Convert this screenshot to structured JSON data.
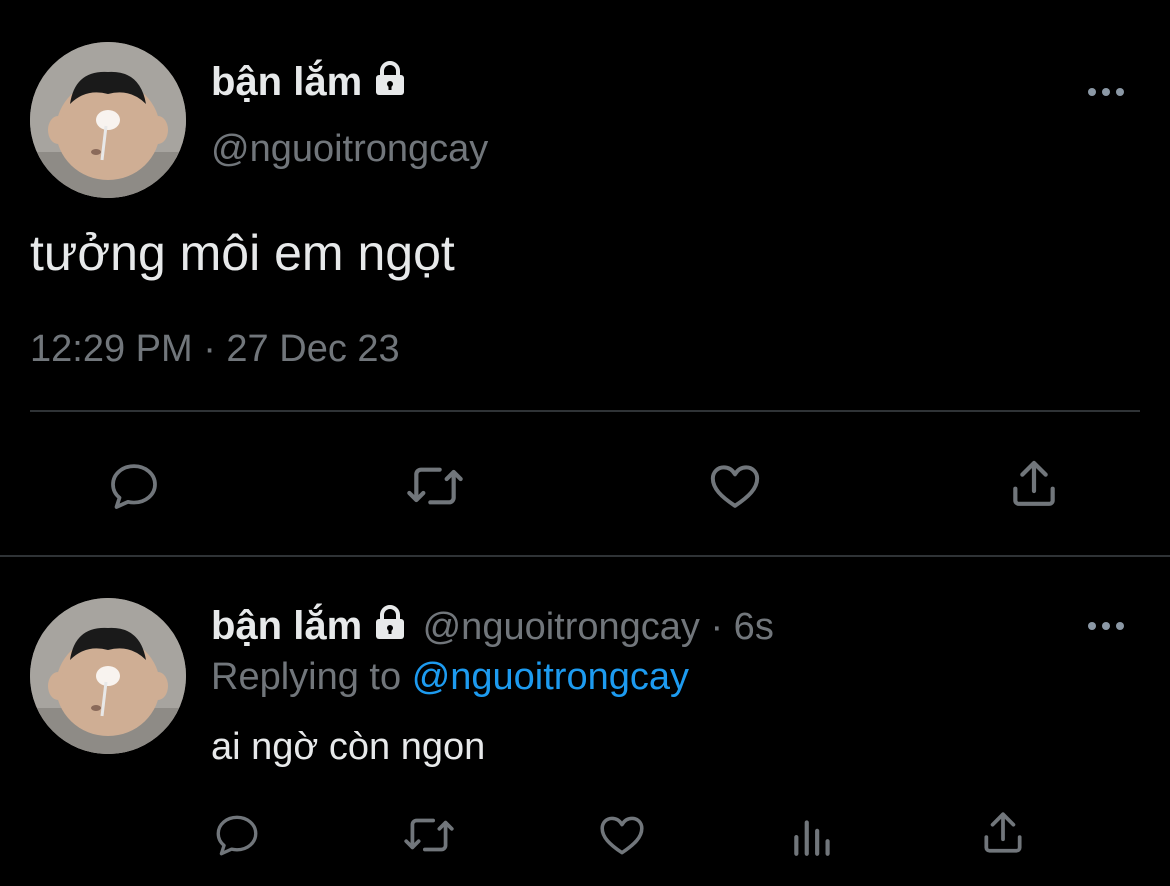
{
  "main_tweet": {
    "display_name": "bận lắm",
    "handle": "@nguoitrongcay",
    "text": "tưởng môi em ngọt",
    "timestamp": "12:29 PM · 27 Dec 23"
  },
  "reply": {
    "display_name": "bận lắm",
    "handle_time": "@nguoitrongcay · 6s",
    "replying_prefix": "Replying to",
    "replying_handle": "@nguoitrongcay",
    "text": "ai ngờ còn ngon"
  },
  "colors": {
    "background": "#000000",
    "primary_text": "#e7e9ea",
    "secondary_text": "#71767b",
    "link": "#1d9bf0",
    "divider": "#2f3336"
  },
  "icons": [
    "lock-icon",
    "more-icon",
    "reply-icon",
    "retweet-icon",
    "like-icon",
    "share-icon",
    "analytics-icon"
  ]
}
